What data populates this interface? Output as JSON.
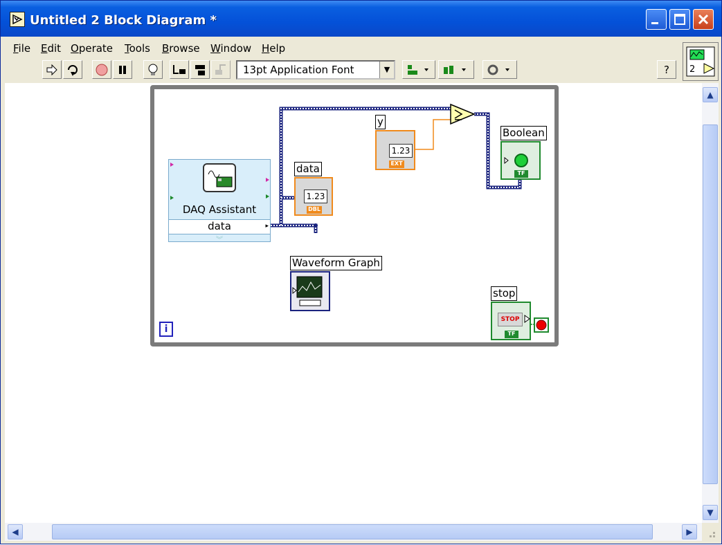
{
  "window": {
    "title": "Untitled 2 Block Diagram *"
  },
  "menu": [
    "File",
    "Edit",
    "Operate",
    "Tools",
    "Browse",
    "Window",
    "Help"
  ],
  "toolbar": {
    "font_select": "13pt Application Font",
    "help_glyph": "?",
    "vi_icon_number": "2"
  },
  "diagram": {
    "daq_assistant": {
      "title": "DAQ Assistant",
      "output": "data"
    },
    "data_indicator": {
      "label": "data",
      "value": "1.23",
      "type": "DBL"
    },
    "y_control": {
      "label": "y",
      "value": "1.23",
      "type": "EXT"
    },
    "boolean_indicator": {
      "label": "Boolean",
      "type": "TF"
    },
    "waveform_graph": {
      "label": "Waveform Graph"
    },
    "stop_control": {
      "label": "stop",
      "button_text": "STOP",
      "type": "TF"
    },
    "iteration_terminal": "i"
  },
  "colors": {
    "title_bar": "#0451d8",
    "wire_dbl": "#f08a1c",
    "wire_dynamic": "#1a237e",
    "wire_bool": "#1f8a2e",
    "loop_border": "#7b7b7b"
  }
}
